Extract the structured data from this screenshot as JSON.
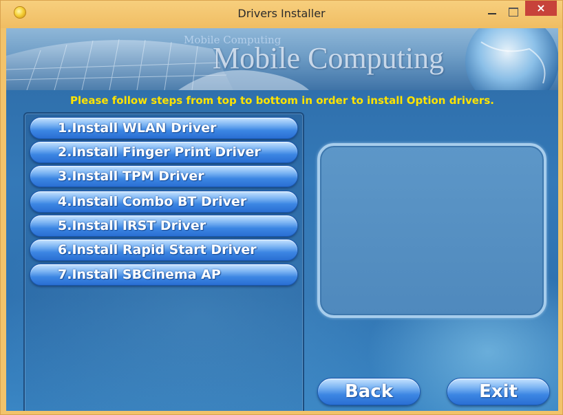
{
  "window": {
    "title": "Drivers Installer",
    "close_glyph": "×"
  },
  "banner": {
    "small_text": "Mobile Computing",
    "big_text": "Mobile Computing"
  },
  "instruction": "Please follow steps from top to bottom in order to install Option drivers.",
  "steps": [
    {
      "label": "1.Install WLAN Driver"
    },
    {
      "label": "2.Install Finger Print Driver"
    },
    {
      "label": "3.Install TPM Driver"
    },
    {
      "label": "4.Install Combo BT Driver"
    },
    {
      "label": "5.Install IRST Driver"
    },
    {
      "label": "6.Install Rapid Start Driver"
    },
    {
      "label": "7.Install SBCinema AP"
    }
  ],
  "nav": {
    "back_label": "Back",
    "exit_label": "Exit"
  },
  "colors": {
    "titlebar": "#f2c36b",
    "close_button": "#c7423a",
    "instruction_text": "#ffe400",
    "button_blue": "#3c86e3",
    "background_blue": "#3479b8"
  },
  "icons": {
    "app": "installer-app-icon",
    "minimize": "minimize-icon",
    "maximize": "maximize-icon",
    "close": "close-icon"
  }
}
